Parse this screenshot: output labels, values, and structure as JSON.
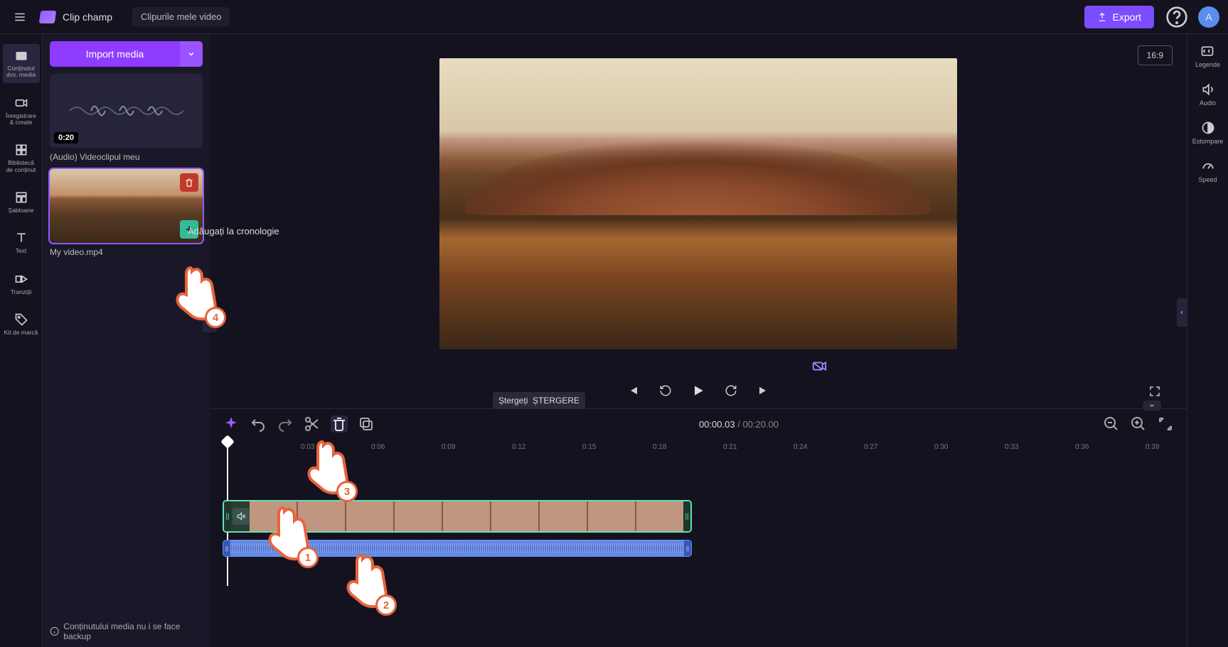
{
  "header": {
    "app_name": "Clip champ",
    "project_title": "Clipurile mele video",
    "export_label": "Export",
    "avatar_letter": "A",
    "aspect_ratio": "16:9"
  },
  "left_rail": {
    "items": [
      {
        "label": "Conținutul dvs. media",
        "icon": "folder"
      },
      {
        "label": "Înregistrare &amp; create",
        "icon": "camera"
      },
      {
        "label": "Bibliotecă de conținut",
        "icon": "library"
      },
      {
        "label": "Șabloane",
        "icon": "templates"
      },
      {
        "label": "Text",
        "icon": "text"
      },
      {
        "label": "Tranziții",
        "icon": "transitions"
      },
      {
        "label": "Kit de marcă",
        "icon": "tag"
      }
    ]
  },
  "media": {
    "import_label": "Import media",
    "items": [
      {
        "name": "(Audio) Videoclipul meu",
        "duration": "0:20",
        "type": "audio"
      },
      {
        "name": "My video.mp4",
        "type": "video",
        "selected": true
      }
    ],
    "add_tooltip": "Adăugați la cronologie",
    "backup_notice": "Conținutului media nu i se face backup"
  },
  "right_rail": {
    "items": [
      {
        "label": "Legende",
        "icon": "cc"
      },
      {
        "label": "Audio",
        "icon": "speaker"
      },
      {
        "label": "Estompare",
        "icon": "fade"
      },
      {
        "label": "Speed",
        "icon": "speedo"
      }
    ]
  },
  "timeline": {
    "delete_tooltip_short": "Ștergeți",
    "delete_tooltip_key": "ȘTERGERE",
    "time_current": "00:00.03",
    "time_total": "00:20.00",
    "ruler": [
      "0:03",
      "0:06",
      "0:09",
      "0:12",
      "0:15",
      "0:18",
      "0:21",
      "0:24",
      "0:27",
      "0:30",
      "0:33",
      "0:36",
      "0:39"
    ]
  },
  "annotations": {
    "p1": "1",
    "p2": "2",
    "p3": "3",
    "p4": "4"
  }
}
